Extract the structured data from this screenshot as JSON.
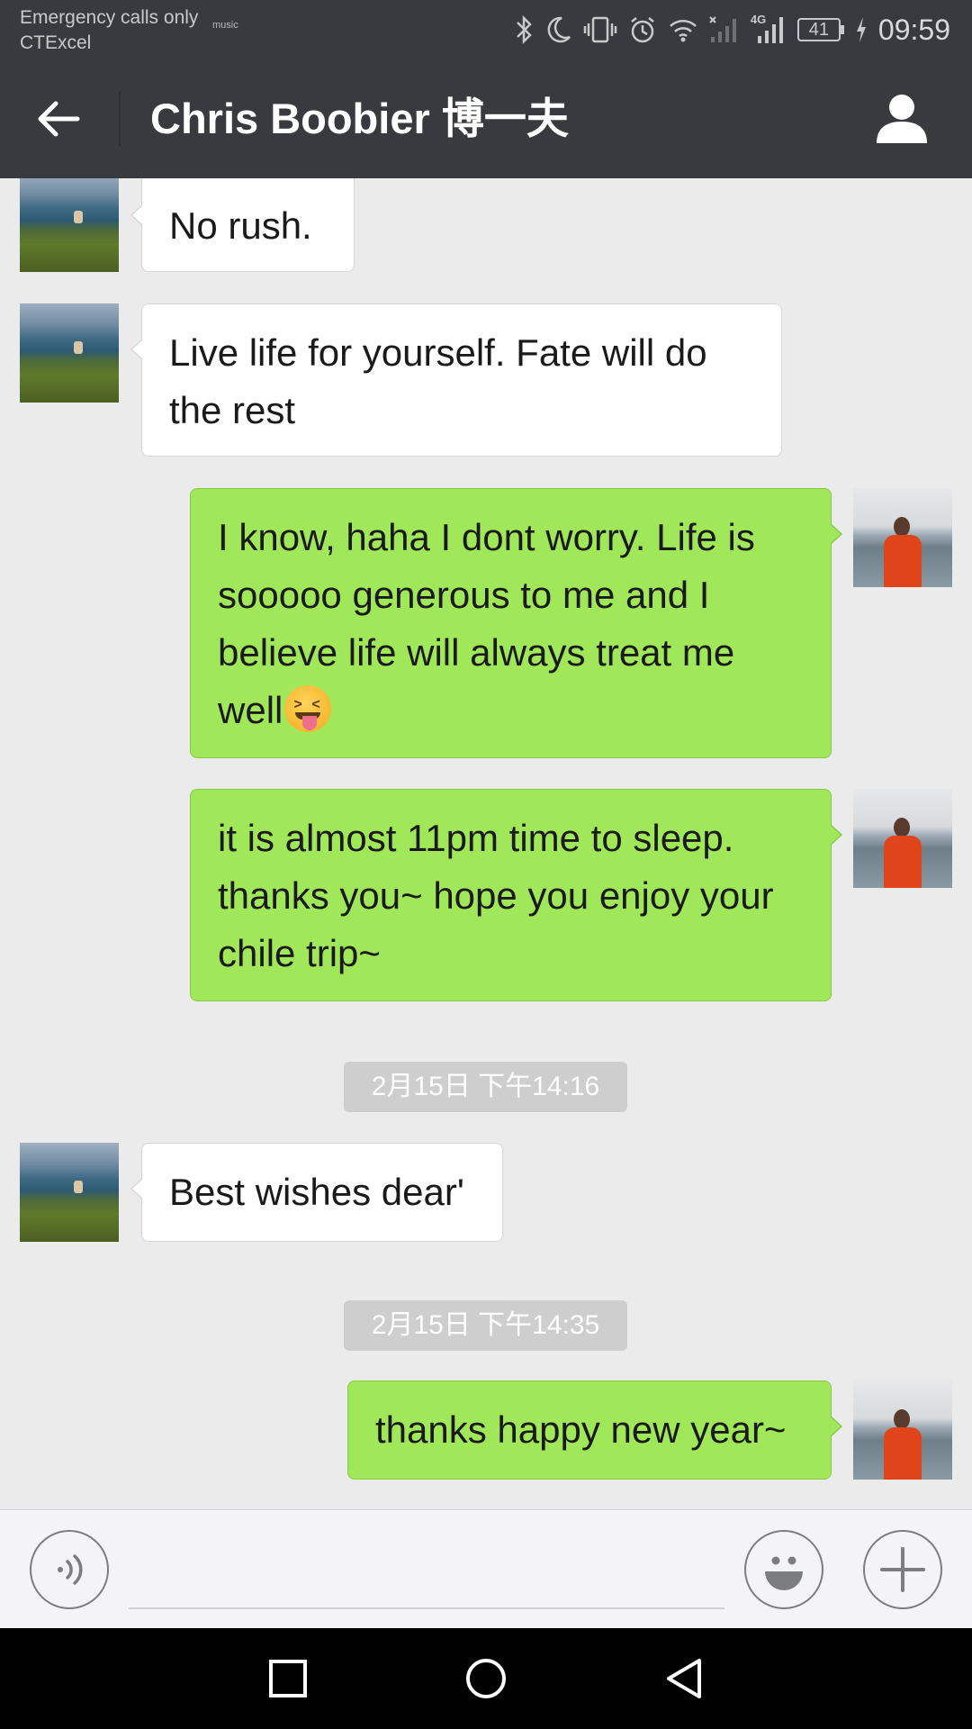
{
  "status_bar": {
    "carrier_line1": "Emergency calls only",
    "carrier_line2": "CTExcel",
    "music_badge": "music",
    "network_label": "4G",
    "battery_level": "41",
    "time": "09:59"
  },
  "header": {
    "title": "Chris Boobier 博一夫",
    "back_icon": "arrow-left-icon",
    "profile_icon": "person-icon"
  },
  "messages": [
    {
      "sender": "them",
      "text": "No rush."
    },
    {
      "sender": "them",
      "text": "Live life for yourself. Fate will do the rest"
    },
    {
      "sender": "me",
      "text": "I know, haha I dont worry. Life is sooooo generous to me and I believe life will always treat me well",
      "emoji": "squinting-face-with-tongue"
    },
    {
      "sender": "me",
      "text": "it is almost 11pm time to sleep. thanks you~  hope you enjoy your chile trip~"
    },
    {
      "type": "timestamp",
      "text": "2月15日 下午14:16"
    },
    {
      "sender": "them",
      "text": "Best wishes dear'"
    },
    {
      "type": "timestamp",
      "text": "2月15日 下午14:35"
    },
    {
      "sender": "me",
      "text": "thanks happy new year~"
    }
  ],
  "input_bar": {
    "voice_icon": "voice-icon",
    "message_value": "",
    "emoji_icon": "smiley-icon",
    "more_icon": "plus-icon"
  },
  "nav_bar": {
    "recents_icon": "square-icon",
    "home_icon": "circle-icon",
    "back_icon": "triangle-back-icon"
  },
  "colors": {
    "header_bg": "#393a3f",
    "chat_bg": "#ebebeb",
    "my_bubble": "#a0e75a",
    "their_bubble": "#ffffff",
    "timestamp_bg": "#cecece"
  }
}
